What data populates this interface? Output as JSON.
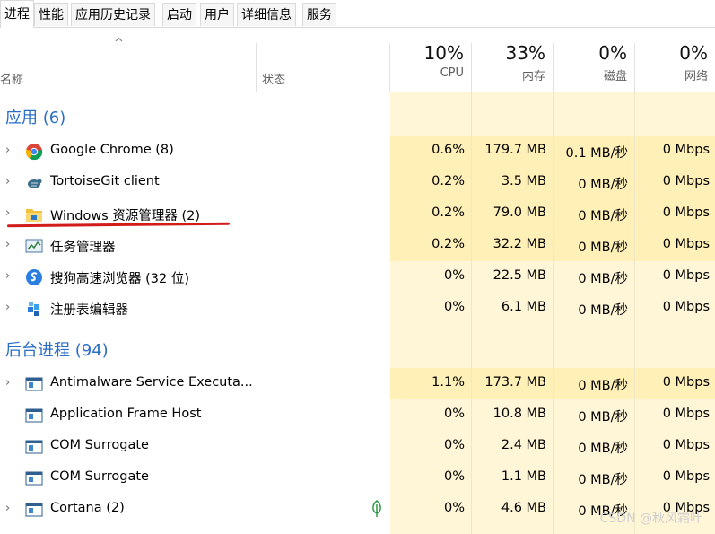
{
  "tabs": [
    "进程",
    "性能",
    "应用历史记录",
    "启动",
    "用户",
    "详细信息",
    "服务"
  ],
  "header": {
    "sort_caret": "^",
    "name_col": "名称",
    "status_col": "状态",
    "cpu_pct": "10%",
    "cpu_label": "CPU",
    "mem_pct": "33%",
    "mem_label": "内存",
    "disk_pct": "0%",
    "disk_label": "磁盘",
    "net_pct": "0%",
    "net_label": "网络"
  },
  "groups": {
    "apps": "应用 (6)",
    "background": "后台进程 (94)"
  },
  "apps": [
    {
      "name": "Google Chrome (8)",
      "cpu": "0.6%",
      "mem": "179.7 MB",
      "disk": "0.1 MB/秒",
      "net": "0 Mbps",
      "icon": "chrome-icon",
      "expand": true
    },
    {
      "name": "TortoiseGit client",
      "cpu": "0.2%",
      "mem": "3.5 MB",
      "disk": "0 MB/秒",
      "net": "0 Mbps",
      "icon": "tortoisegit-icon",
      "expand": true
    },
    {
      "name": "Windows 资源管理器 (2)",
      "cpu": "0.2%",
      "mem": "79.0 MB",
      "disk": "0 MB/秒",
      "net": "0 Mbps",
      "icon": "folder-icon",
      "expand": true
    },
    {
      "name": "任务管理器",
      "cpu": "0.2%",
      "mem": "32.2 MB",
      "disk": "0 MB/秒",
      "net": "0 Mbps",
      "icon": "task-manager-icon",
      "expand": true
    },
    {
      "name": "搜狗高速浏览器 (32 位)",
      "cpu": "0%",
      "mem": "22.5 MB",
      "disk": "0 MB/秒",
      "net": "0 Mbps",
      "icon": "sogou-browser-icon",
      "expand": true
    },
    {
      "name": "注册表编辑器",
      "cpu": "0%",
      "mem": "6.1 MB",
      "disk": "0 MB/秒",
      "net": "0 Mbps",
      "icon": "registry-editor-icon",
      "expand": true
    }
  ],
  "background": [
    {
      "name": "Antimalware Service Executa...",
      "cpu": "1.1%",
      "mem": "173.7 MB",
      "disk": "0 MB/秒",
      "net": "0 Mbps",
      "icon": "service-window-icon",
      "expand": true
    },
    {
      "name": "Application Frame Host",
      "cpu": "0%",
      "mem": "10.8 MB",
      "disk": "0 MB/秒",
      "net": "0 Mbps",
      "icon": "service-window-icon",
      "expand": false
    },
    {
      "name": "COM Surrogate",
      "cpu": "0%",
      "mem": "2.4 MB",
      "disk": "0 MB/秒",
      "net": "0 Mbps",
      "icon": "service-window-icon",
      "expand": false
    },
    {
      "name": "COM Surrogate",
      "cpu": "0%",
      "mem": "1.1 MB",
      "disk": "0 MB/秒",
      "net": "0 Mbps",
      "icon": "service-window-icon",
      "expand": false
    },
    {
      "name": "Cortana (2)",
      "cpu": "0%",
      "mem": "4.6 MB",
      "disk": "0 MB/秒",
      "net": "0 Mbps",
      "icon": "service-window-icon",
      "expand": true,
      "status_icon": "leaf-icon"
    }
  ],
  "watermark": "CSDN @秋风霜叶",
  "colors": {
    "accent": "#2b6ec5",
    "highlight": "#fff0b8",
    "column_bg": "#fff6d8",
    "annotation": "#d21c1c"
  }
}
